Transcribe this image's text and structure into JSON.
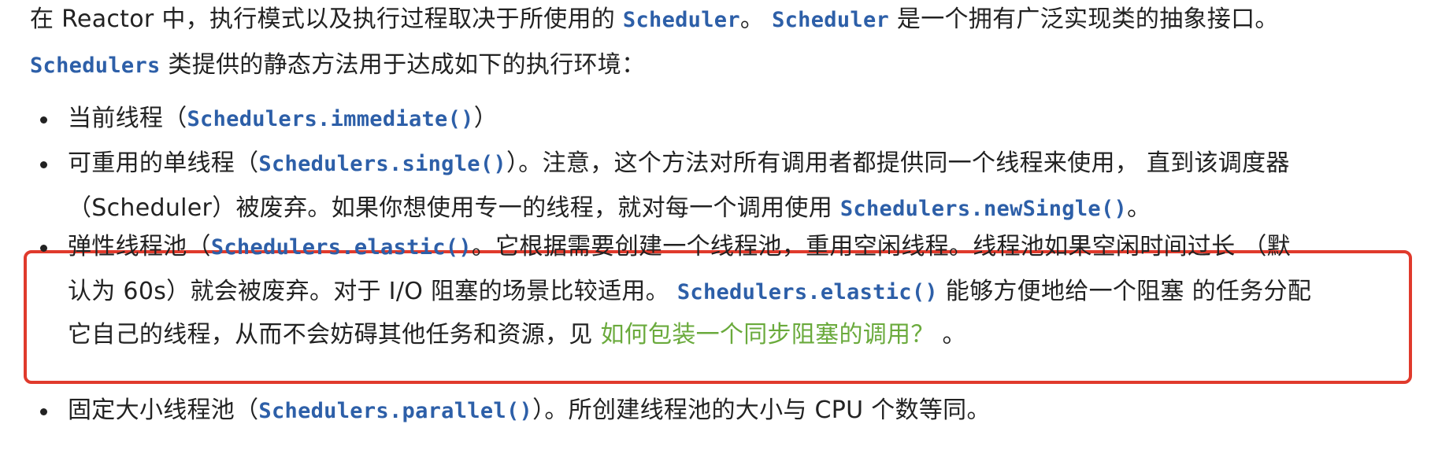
{
  "intro": {
    "l1_a": "在 Reactor 中，执行模式以及执行过程取决于所使用的",
    "l1_code1": "Scheduler",
    "l1_b": "。",
    "l1_code2": "Scheduler",
    "l1_c": "是一个拥有广泛实现类的抽象接口。",
    "l2_code": "Schedulers",
    "l2_a": "类提供的静态方法用于达成如下的执行环境："
  },
  "items": [
    {
      "a": "当前线程（",
      "code": "Schedulers.immediate()",
      "b": "）"
    },
    {
      "a": "可重用的单线程（",
      "code": "Schedulers.single()",
      "b": "）。注意，这个方法对所有调用者都提供同一个线程来使用， 直到该调度器",
      "c": "（Scheduler）被废弃。如果你想使用专一的线程，就对每一个调用使用",
      "code2": "Schedulers.newSingle()",
      "d": "。"
    },
    {
      "a": "弹性线程池（",
      "code": "Schedulers.elastic()",
      "b": "。它根据需要创建一个线程池，重用空闲线程。线程池如果空闲时间过长 （默",
      "c": "认为 60s）就会被废弃。对于 I/O 阻塞的场景比较适用。",
      "code2": "Schedulers.elastic()",
      "d": "能够方便地给一个阻塞 的任务分配",
      "e": "它自己的线程，从而不会妨碍其他任务和资源，见",
      "link": "如何包装一个同步阻塞的调用？",
      "f": "。"
    },
    {
      "a": "固定大小线程池（",
      "code": "Schedulers.parallel()",
      "b": "）。所创建线程池的大小与 CPU 个数等同。"
    }
  ]
}
